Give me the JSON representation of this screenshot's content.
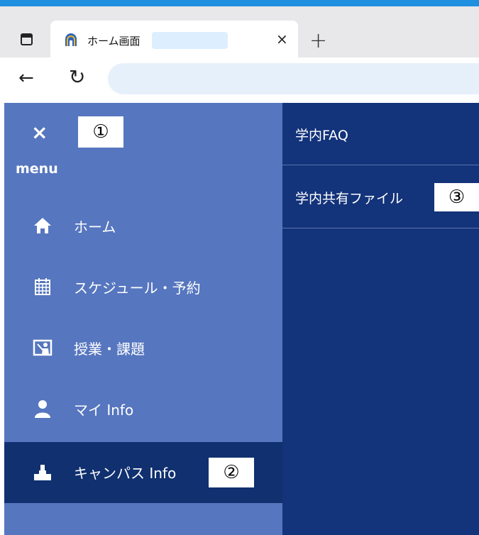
{
  "browser": {
    "tab_title": "ホーム画面",
    "tab_close": "×",
    "new_tab": "+",
    "back": "←",
    "reload": "↻",
    "address_value": ""
  },
  "sidebar": {
    "close_label": "×",
    "menu_label": "menu",
    "annotation_1": "①",
    "items": [
      {
        "label": "ホーム",
        "icon": "home-icon"
      },
      {
        "label": "スケジュール・予約",
        "icon": "calendar-icon"
      },
      {
        "label": "授業・課題",
        "icon": "classroom-icon"
      },
      {
        "label": "マイ Info",
        "icon": "person-icon"
      },
      {
        "label": "キャンパス Info",
        "icon": "campus-icon"
      }
    ],
    "annotation_2": "②"
  },
  "main": {
    "items": [
      {
        "label": "学内FAQ"
      },
      {
        "label": "学内共有ファイル"
      }
    ],
    "annotation_3": "③"
  },
  "colors": {
    "sidebar_bg": "#5676bf",
    "active_bg": "#10306f",
    "main_bg": "#13337a",
    "accent_strip": "#1f8fe0"
  }
}
